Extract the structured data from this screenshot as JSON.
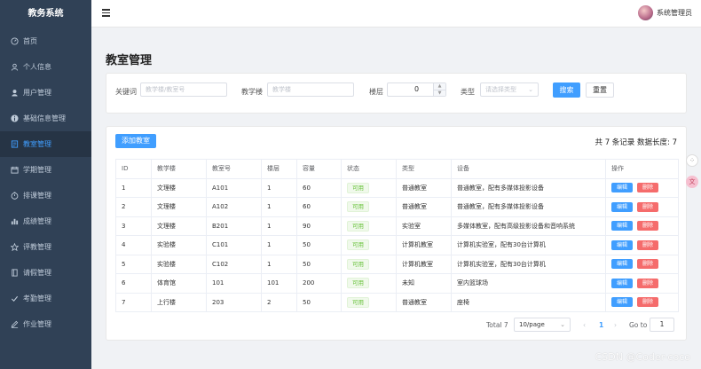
{
  "app": {
    "title": "教务系统"
  },
  "sidebar": {
    "items": [
      {
        "label": "首页",
        "icon": "dashboard-icon"
      },
      {
        "label": "个人信息",
        "icon": "user-outline-icon"
      },
      {
        "label": "用户管理",
        "icon": "user-icon"
      },
      {
        "label": "基础信息管理",
        "icon": "info-icon"
      },
      {
        "label": "教室管理",
        "icon": "classroom-icon",
        "active": true
      },
      {
        "label": "学期管理",
        "icon": "calendar-icon"
      },
      {
        "label": "排课管理",
        "icon": "timer-icon"
      },
      {
        "label": "成绩管理",
        "icon": "bar-chart-icon"
      },
      {
        "label": "评教管理",
        "icon": "star-icon"
      },
      {
        "label": "请假管理",
        "icon": "document-icon"
      },
      {
        "label": "考勤管理",
        "icon": "check-icon"
      },
      {
        "label": "作业管理",
        "icon": "edit-icon"
      }
    ]
  },
  "header": {
    "username": "系统管理员"
  },
  "page": {
    "title": "教室管理"
  },
  "search": {
    "keyword_label": "关键词",
    "keyword_placeholder": "教学楼/教室号",
    "building_label": "教学楼",
    "building_placeholder": "教学楼",
    "floor_label": "楼层",
    "floor_value": "0",
    "type_label": "类型",
    "type_placeholder": "请选择类型",
    "search_btn": "搜索",
    "reset_btn": "重置"
  },
  "table_card": {
    "add_btn": "添加教室",
    "record_info": "共 7 条记录   数据长度: 7"
  },
  "table": {
    "headers": [
      "ID",
      "教学楼",
      "教室号",
      "楼层",
      "容量",
      "状态",
      "类型",
      "设备",
      "操作"
    ],
    "rows": [
      [
        "1",
        "文理楼",
        "A101",
        "1",
        "60",
        "可用",
        "普通教室",
        "普通教室，配有多媒体投影设备"
      ],
      [
        "2",
        "文理楼",
        "A102",
        "1",
        "60",
        "可用",
        "普通教室",
        "普通教室，配有多媒体投影设备"
      ],
      [
        "3",
        "文理楼",
        "B201",
        "1",
        "90",
        "可用",
        "实验室",
        "多媒体教室，配有高级投影设备和音响系统"
      ],
      [
        "4",
        "实验楼",
        "C101",
        "1",
        "50",
        "可用",
        "计算机教室",
        "计算机实验室，配有30台计算机"
      ],
      [
        "5",
        "实验楼",
        "C102",
        "1",
        "50",
        "可用",
        "计算机教室",
        "计算机实验室，配有30台计算机"
      ],
      [
        "6",
        "体育馆",
        "101",
        "101",
        "200",
        "可用",
        "未知",
        "室内篮球场"
      ],
      [
        "7",
        "上行楼",
        "203",
        "2",
        "50",
        "可用",
        "普通教室",
        "座椅"
      ]
    ],
    "edit_label": "编辑",
    "delete_label": "删除"
  },
  "pagination": {
    "total": "Total 7",
    "page_size": "10/page",
    "current": "1",
    "goto_label": "Go to",
    "goto_value": "1"
  },
  "watermark": "CSDN @Coder-coco",
  "colors": {
    "sidebar_bg": "#304156",
    "primary": "#409eff",
    "danger": "#f56c6c",
    "success": "#67c23a"
  }
}
